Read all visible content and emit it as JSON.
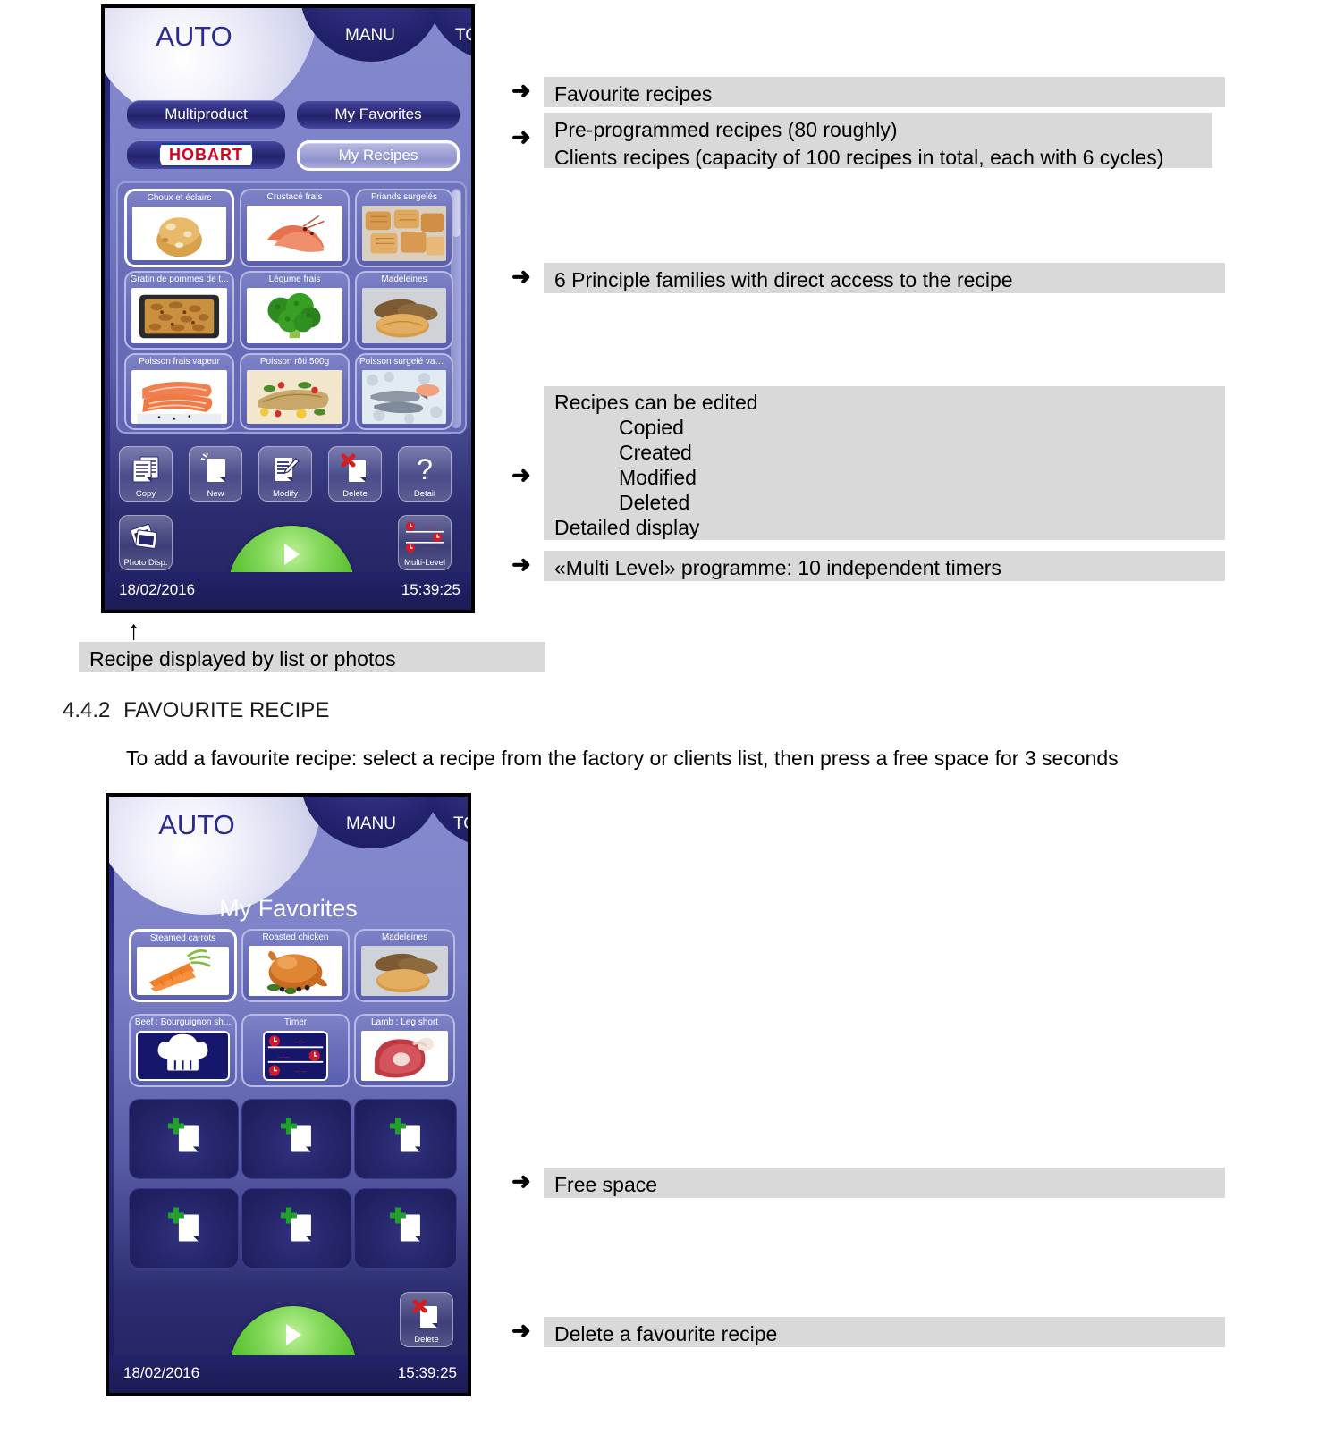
{
  "device1": {
    "tabs": [
      {
        "label": "AUTO",
        "active": true
      },
      {
        "label": "MANU",
        "active": false
      },
      {
        "label": "TOOL BOX",
        "active": false
      }
    ],
    "nav_buttons": [
      {
        "label": "Multiproduct",
        "selected": false
      },
      {
        "label": "My Favorites",
        "selected": false
      },
      {
        "label": "HOBART",
        "selected": false,
        "brand": true
      },
      {
        "label": "My Recipes",
        "selected": true
      }
    ],
    "recipes": [
      {
        "label": "Choux et éclairs",
        "image": "cream-puff",
        "selected": true
      },
      {
        "label": "Crustacé frais",
        "image": "prawns",
        "selected": false
      },
      {
        "label": "Friands surgelés",
        "image": "pastry-rolls",
        "selected": false
      },
      {
        "label": "Gratin de pommes de t...",
        "image": "gratin-tray",
        "selected": false
      },
      {
        "label": "Légume frais",
        "image": "broccoli",
        "selected": false
      },
      {
        "label": "Madeleines",
        "image": "madeleines",
        "selected": false
      },
      {
        "label": "Poisson frais vapeur",
        "image": "salmon-fillets",
        "selected": false
      },
      {
        "label": "Poisson rôti 500g",
        "image": "roasted-fish",
        "selected": false
      },
      {
        "label": "Poisson surgelé vape...",
        "image": "frozen-fish-ice",
        "selected": false
      }
    ],
    "toolbar": [
      {
        "label": "Copy",
        "icon": "copy-document-icon"
      },
      {
        "label": "New",
        "icon": "new-document-icon"
      },
      {
        "label": "Modify",
        "icon": "edit-document-icon"
      },
      {
        "label": "Delete",
        "icon": "delete-document-icon"
      },
      {
        "label": "Detail",
        "icon": "question-mark-icon"
      }
    ],
    "photo_display": {
      "label": "Photo Disp.",
      "icon": "photo-stack-icon"
    },
    "multi_level": {
      "label": "Multi-Level",
      "icon": "multi-timer-icon"
    },
    "start": {
      "label": "START",
      "icon": "play-icon"
    },
    "status": {
      "date": "18/02/2016",
      "time": "15:39:25"
    }
  },
  "annotations1": [
    {
      "text": "Favourite recipes"
    },
    {
      "line1": "Pre-programmed recipes (80 roughly)",
      "line2": "Clients recipes (capacity of 100 recipes in total, each with 6 cycles)"
    },
    {
      "text": "6 Principle families with direct access to the recipe"
    },
    {
      "line1": "Recipes can be edited",
      "items": [
        "Copied",
        "Created",
        "Modified",
        "Deleted"
      ],
      "line2": "Detailed display"
    },
    {
      "text": "«Multi Level» programme: 10 independent timers"
    }
  ],
  "caption_bottom": "Recipe displayed by list or photos",
  "section": {
    "number": "4.4.2",
    "title": "FAVOURITE RECIPE",
    "paragraph": "To add a favourite recipe: select a recipe from the factory or clients list, then press a free space for 3 seconds"
  },
  "device2": {
    "tabs": [
      {
        "label": "AUTO",
        "active": true
      },
      {
        "label": "MANU",
        "active": false
      },
      {
        "label": "TOOL BOX",
        "active": false
      }
    ],
    "title": "My Favorites",
    "favorites": [
      {
        "label": "Steamed carrots",
        "image": "carrots",
        "selected": true
      },
      {
        "label": "Roasted chicken",
        "image": "roast-chicken",
        "selected": false
      },
      {
        "label": "Madeleines",
        "image": "madeleines",
        "selected": false
      },
      {
        "label": "Beef : Bourguignon sh...",
        "image": "chef-hat-icon",
        "selected": false
      },
      {
        "label": "Timer",
        "image": "multi-timer-icon",
        "selected": false
      },
      {
        "label": "Lamb : Leg short",
        "image": "lamb-leg",
        "selected": false
      }
    ],
    "free_slots_count": 6,
    "free_slot_icon": "add-document-icon",
    "delete": {
      "label": "Delete",
      "icon": "delete-document-icon"
    },
    "start": {
      "label": "START",
      "icon": "play-icon"
    },
    "status": {
      "date": "18/02/2016",
      "time": "15:39:25"
    }
  },
  "annotations2": [
    {
      "text": "Free space"
    },
    {
      "text": "Delete a favourite recipe"
    }
  ],
  "colors": {
    "annotation_bg": "#d9d9d9",
    "device_bg": "#7b7fc4",
    "start_green": "#4fbc2a",
    "brand_red": "#d6001c",
    "brand_blue": "#15399c",
    "accent_plus": "#22a02c"
  }
}
